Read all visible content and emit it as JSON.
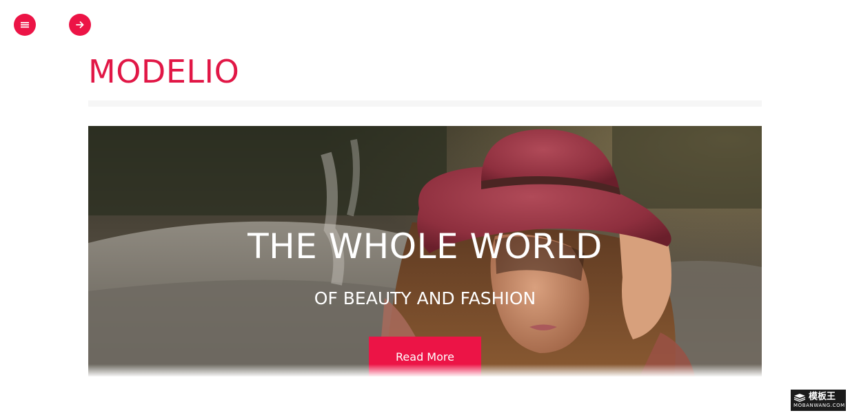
{
  "nav": {
    "menu_icon": "menu-icon",
    "next_icon": "arrow-right-icon"
  },
  "brand": {
    "name": "MODELIO"
  },
  "hero": {
    "title": "THE WHOLE WORLD",
    "subtitle": "OF BEAUTY AND FASHION",
    "cta_label": "Read More"
  },
  "watermark": {
    "top_text": "模板王",
    "bottom_text": "MOBANWANG.COM"
  },
  "colors": {
    "accent": "#ec1446",
    "brand_text": "#e11746"
  }
}
